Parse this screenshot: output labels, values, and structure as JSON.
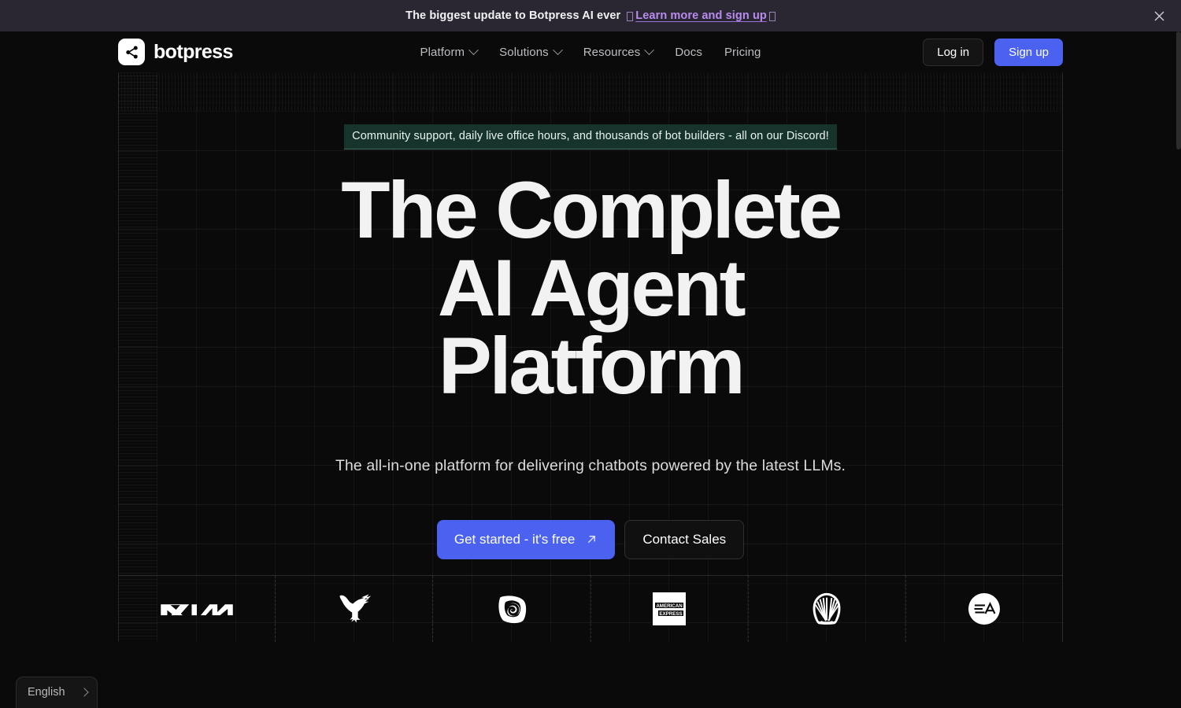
{
  "banner": {
    "text": "The biggest update to Botpress AI ever",
    "link_label": "Learn more and sign up",
    "close_icon": "close-icon"
  },
  "header": {
    "brand": "botpress",
    "logo_icon": "share-nodes-icon",
    "nav": [
      {
        "label": "Platform",
        "has_dropdown": true
      },
      {
        "label": "Solutions",
        "has_dropdown": true
      },
      {
        "label": "Resources",
        "has_dropdown": true
      },
      {
        "label": "Docs",
        "has_dropdown": false
      },
      {
        "label": "Pricing",
        "has_dropdown": false
      }
    ],
    "login_label": "Log in",
    "signup_label": "Sign up"
  },
  "hero": {
    "eyebrow": "Community support, daily live office hours, and thousands of bot builders - all on our Discord!",
    "headline_line1": "The Complete",
    "headline_line2": "AI Agent",
    "headline_line3": "Platform",
    "subhead": "The all-in-one platform for delivering chatbots powered by the latest LLMs.",
    "primary_cta": "Get started - it's free",
    "primary_cta_icon": "arrow-up-right-icon",
    "secondary_cta": "Contact Sales"
  },
  "logos": [
    {
      "name": "kia-logo",
      "label": "KIA"
    },
    {
      "name": "eagle-logo",
      "label": "American Eagle"
    },
    {
      "name": "swirl-logo",
      "label": "Swirl"
    },
    {
      "name": "american-express-logo",
      "label": "AMERICAN EXPRESS"
    },
    {
      "name": "shell-logo",
      "label": "Shell"
    },
    {
      "name": "ea-logo",
      "label": "EA"
    }
  ],
  "language": {
    "label": "English",
    "chevron_icon": "chevron-right-icon"
  },
  "colors": {
    "background": "#0a0a0a",
    "banner_bg": "#2a2733",
    "banner_link": "#b98cf0",
    "accent_blue": "#4b61f0",
    "eyebrow_bg": "#16332c",
    "text_primary": "#f2f2f2",
    "text_muted": "#bdbdc2"
  }
}
